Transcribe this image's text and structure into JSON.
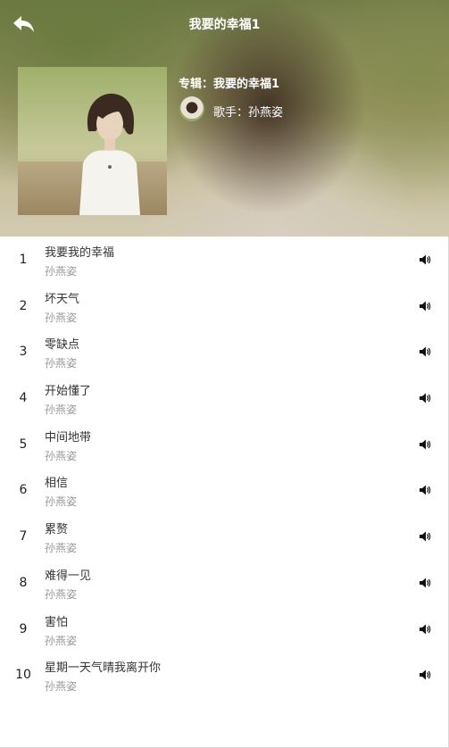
{
  "header": {
    "title": "我要的幸福1",
    "album_label": "专辑：我要的幸福1",
    "singer_label": "歌手：孙燕姿"
  },
  "icons": {
    "back": "back-arrow-icon",
    "play": "speaker-icon"
  },
  "songs": [
    {
      "index": "1",
      "title": "我要我的幸福",
      "artist": "孙燕姿"
    },
    {
      "index": "2",
      "title": "坏天气",
      "artist": "孙燕姿"
    },
    {
      "index": "3",
      "title": "零缺点",
      "artist": "孙燕姿"
    },
    {
      "index": "4",
      "title": "开始懂了",
      "artist": "孙燕姿"
    },
    {
      "index": "5",
      "title": "中间地带",
      "artist": "孙燕姿"
    },
    {
      "index": "6",
      "title": "相信",
      "artist": "孙燕姿"
    },
    {
      "index": "7",
      "title": "累赘",
      "artist": "孙燕姿"
    },
    {
      "index": "8",
      "title": "难得一见",
      "artist": "孙燕姿"
    },
    {
      "index": "9",
      "title": "害怕",
      "artist": "孙燕姿"
    },
    {
      "index": "10",
      "title": "星期一天气晴我离开你",
      "artist": "孙燕姿"
    }
  ]
}
